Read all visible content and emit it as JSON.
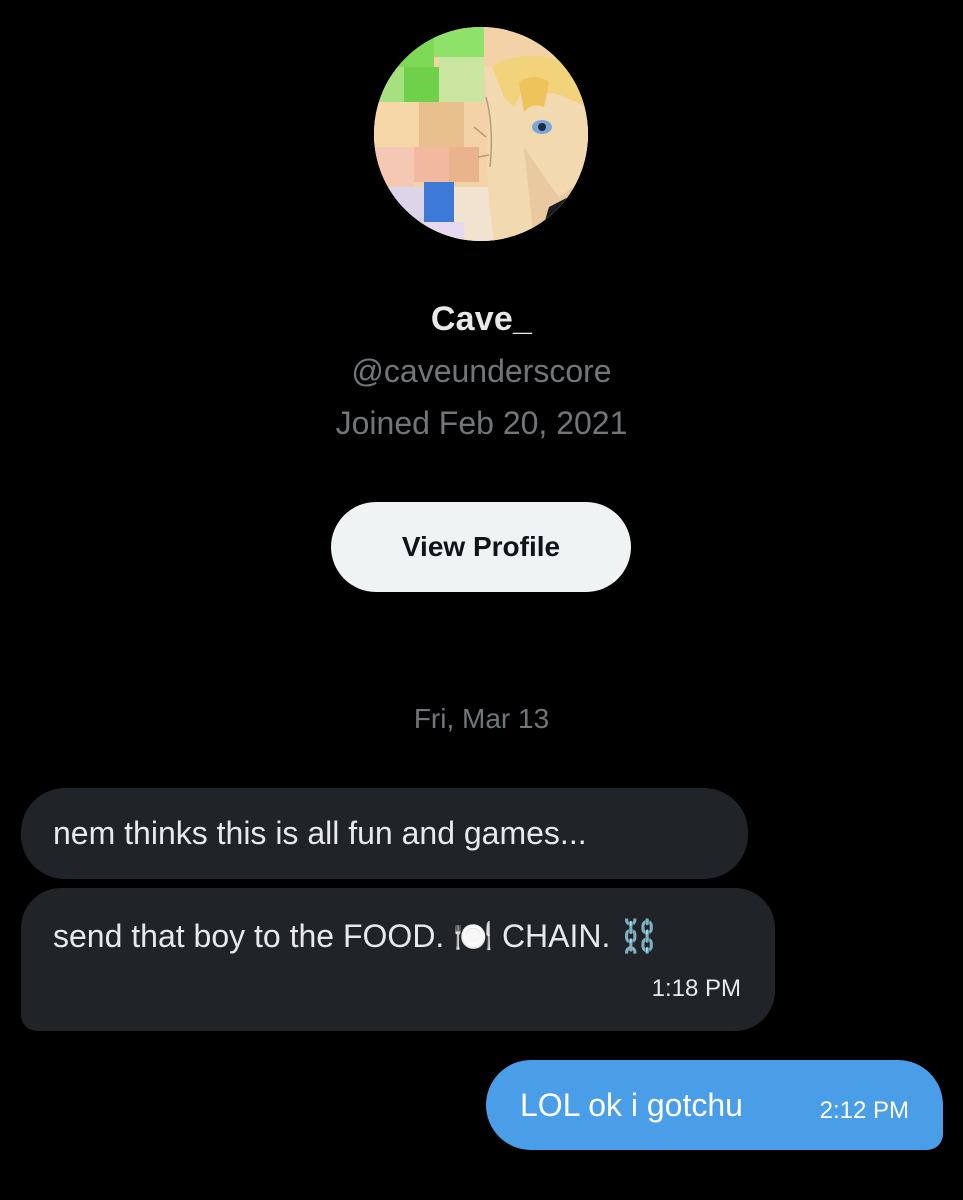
{
  "profile": {
    "display_name": "Cave_",
    "handle": "@caveunderscore",
    "joined": "Joined Feb 20, 2021",
    "view_profile_label": "View Profile"
  },
  "conversation": {
    "date_separator": "Fri, Mar 13",
    "messages": [
      {
        "direction": "incoming",
        "text": "nem thinks this is all fun and games..."
      },
      {
        "direction": "incoming",
        "text": "send that boy to the FOOD. 🍽️ CHAIN. ⛓️",
        "time": "1:18 PM"
      },
      {
        "direction": "outgoing",
        "text": "LOL ok i gotchu",
        "time": "2:12 PM"
      }
    ]
  },
  "colors": {
    "background": "#000000",
    "incoming_bubble": "#202327",
    "outgoing_bubble": "#4a9ee8",
    "secondary_text": "#71767b",
    "button_bg": "#eff3f4"
  }
}
